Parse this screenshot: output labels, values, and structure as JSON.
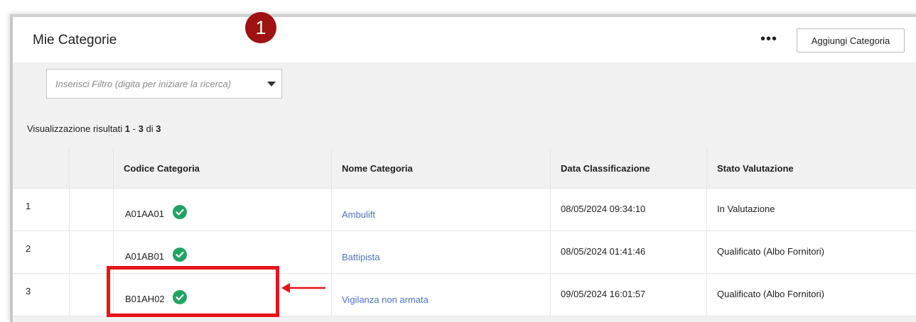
{
  "header": {
    "title": "Mie Categorie",
    "step_number": "1",
    "more_icon": "more-horizontal-icon",
    "add_button_label": "Aggiungi Categoria"
  },
  "filter": {
    "placeholder": "Inserisci Filtro (digita per iniziare la ricerca)",
    "value": "",
    "dropdown_icon": "caret-down-icon"
  },
  "results": {
    "prefix": "Visualizzazione risultati",
    "from": "1",
    "sep": "-",
    "to": "3",
    "of_label": "di",
    "total": "3"
  },
  "table": {
    "columns": [
      "",
      "",
      "Codice Categoria",
      "Nome Categoria",
      "Data Classificazione",
      "Stato Valutazione"
    ],
    "rows": [
      {
        "index": "1",
        "code": "A01AA01",
        "name": "Ambulift",
        "date": "08/05/2024 09:34:10",
        "status": "In Valutazione"
      },
      {
        "index": "2",
        "code": "A01AB01",
        "name": "Battipista",
        "date": "08/05/2024 01:41:46",
        "status": "Qualificato (Albo Fornitori)"
      },
      {
        "index": "3",
        "code": "B01AH02",
        "name": "Vigilanza non armata",
        "date": "09/05/2024 16:01:57",
        "status": "Qualificato (Albo Fornitori)"
      }
    ]
  },
  "colors": {
    "badge": "#9f1212",
    "highlight": "#e8141b",
    "link": "#4a74c9",
    "check": "#1fa463"
  }
}
